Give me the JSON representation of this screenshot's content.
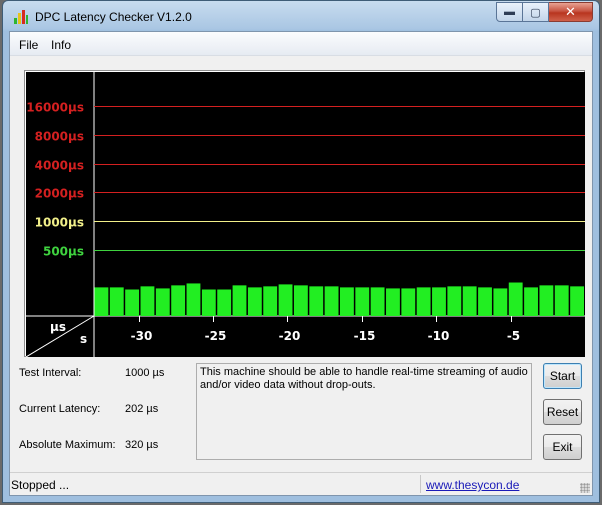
{
  "window": {
    "title": "DPC Latency Checker V1.2.0",
    "controls": {
      "minimize": "▬",
      "maximize": "▢",
      "close": "✕"
    }
  },
  "menu": {
    "items": [
      "File",
      "Info"
    ]
  },
  "chart_data": {
    "type": "bar",
    "x_axis": {
      "unit_label": "s",
      "range": [
        -33,
        0
      ],
      "ticks": [
        -30,
        -25,
        -20,
        -15,
        -10,
        -5
      ]
    },
    "y_axis": {
      "unit_label": "µs",
      "scale": "log",
      "range": [
        0,
        25000
      ],
      "levels": [
        {
          "label": "16000µs",
          "value": 16000,
          "color": "#d42020"
        },
        {
          "label": "8000µs",
          "value": 8000,
          "color": "#d42020"
        },
        {
          "label": "4000µs",
          "value": 4000,
          "color": "#d42020"
        },
        {
          "label": "2000µs",
          "value": 2000,
          "color": "#d42020"
        },
        {
          "label": "1000µs",
          "value": 1000,
          "color": "#f2f08a"
        },
        {
          "label": "500µs",
          "value": 500,
          "color": "#3fd23f"
        }
      ]
    },
    "bar_color": "#22ee22",
    "values": [
      200,
      200,
      190,
      205,
      195,
      210,
      220,
      190,
      190,
      210,
      200,
      205,
      215,
      210,
      205,
      205,
      200,
      200,
      200,
      195,
      195,
      200,
      200,
      205,
      205,
      200,
      195,
      225,
      200,
      210,
      210,
      205
    ]
  },
  "stats": {
    "test_interval": {
      "label": "Test Interval:",
      "value": "1000 µs"
    },
    "current_latency": {
      "label": "Current Latency:",
      "value": "202 µs"
    },
    "absolute_maximum": {
      "label": "Absolute Maximum:",
      "value": "320 µs"
    }
  },
  "message": "This machine should be able to handle real-time streaming of audio and/or video data without drop-outs.",
  "buttons": {
    "start": "Start",
    "reset": "Reset",
    "exit": "Exit"
  },
  "status": {
    "text": "Stopped ...",
    "link": "www.thesycon.de"
  }
}
